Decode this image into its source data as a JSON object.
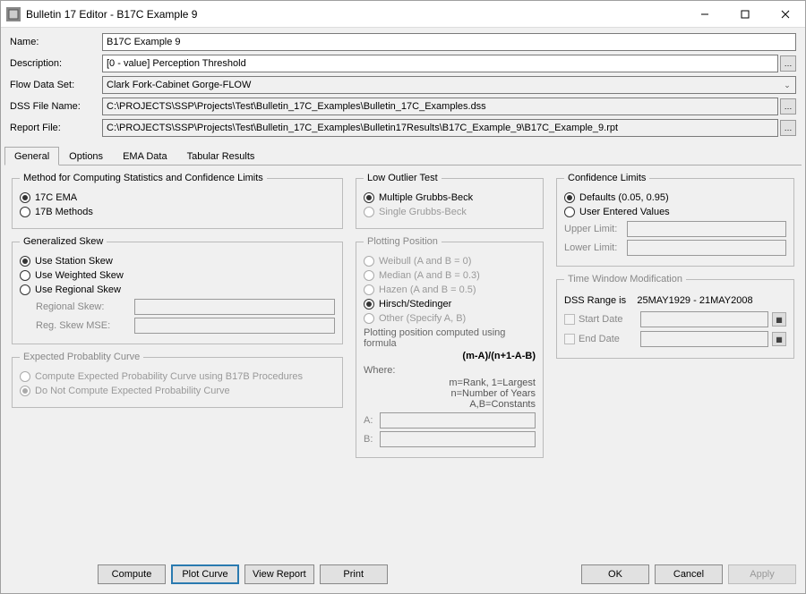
{
  "window": {
    "title": "Bulletin 17 Editor - B17C Example 9"
  },
  "form": {
    "name_label": "Name:",
    "name_value": "B17C Example 9",
    "desc_label": "Description:",
    "desc_value": "[0 - value] Perception Threshold",
    "flow_label": "Flow Data Set:",
    "flow_value": "Clark Fork-Cabinet Gorge-FLOW",
    "dss_label": "DSS File Name:",
    "dss_value": "C:\\PROJECTS\\SSP\\Projects\\Test\\Bulletin_17C_Examples\\Bulletin_17C_Examples.dss",
    "report_label": "Report File:",
    "report_value": "C:\\PROJECTS\\SSP\\Projects\\Test\\Bulletin_17C_Examples\\Bulletin17Results\\B17C_Example_9\\B17C_Example_9.rpt"
  },
  "tabs": {
    "general": "General",
    "options": "Options",
    "ema": "EMA Data",
    "tabular": "Tabular Results"
  },
  "method": {
    "legend": "Method for Computing Statistics and Confidence Limits",
    "ema": "17C EMA",
    "b17b": "17B Methods"
  },
  "skew": {
    "legend": "Generalized Skew",
    "station": "Use Station Skew",
    "weighted": "Use Weighted Skew",
    "regional": "Use Regional Skew",
    "reg_skew_label": "Regional Skew:",
    "reg_mse_label": "Reg. Skew MSE:"
  },
  "expected": {
    "legend": "Expected Probablity Curve",
    "compute": "Compute Expected Probability Curve using B17B Procedures",
    "do_not": "Do Not Compute Expected Probability Curve"
  },
  "outlier": {
    "legend": "Low Outlier Test",
    "multiple": "Multiple Grubbs-Beck",
    "single": "Single Grubbs-Beck"
  },
  "plotting": {
    "legend": "Plotting Position",
    "weibull": "Weibull (A and B = 0)",
    "median": "Median (A and B = 0.3)",
    "hazen": "Hazen (A and B = 0.5)",
    "hirsch": "Hirsch/Stedinger",
    "other": "Other (Specify A, B)",
    "formula1": "Plotting position computed using formula",
    "formula2": "(m-A)/(n+1-A-B)",
    "where": "Where:",
    "line_m": "m=Rank, 1=Largest",
    "line_n": "n=Number of Years",
    "line_ab": "A,B=Constants",
    "a_label": "A:",
    "b_label": "B:"
  },
  "confidence": {
    "legend": "Confidence Limits",
    "defaults": "Defaults (0.05, 0.95)",
    "user": "User Entered Values",
    "upper": "Upper Limit:",
    "lower": "Lower Limit:"
  },
  "timewin": {
    "legend": "Time Window Modification",
    "range_label": "DSS Range is",
    "range_value": "25MAY1929 - 21MAY2008",
    "start": "Start Date",
    "end": "End Date"
  },
  "buttons": {
    "compute": "Compute",
    "plot": "Plot Curve",
    "view": "View Report",
    "print": "Print",
    "ok": "OK",
    "cancel": "Cancel",
    "apply": "Apply"
  }
}
